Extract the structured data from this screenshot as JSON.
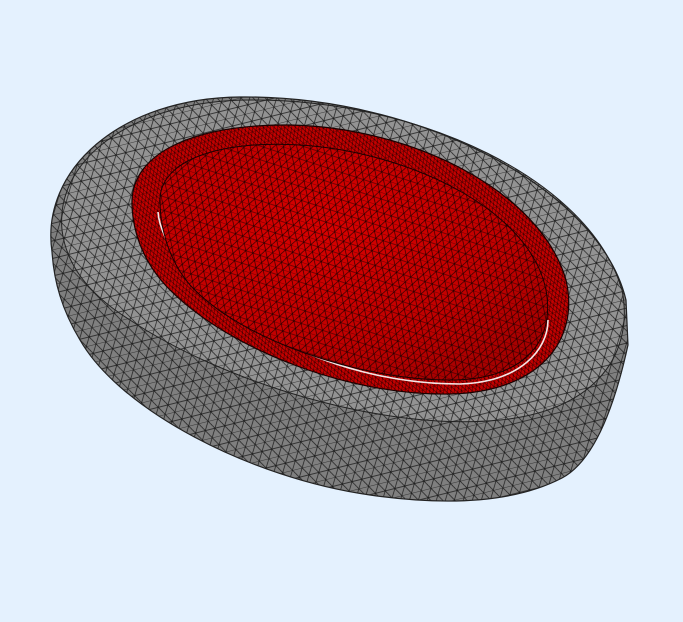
{
  "scene": {
    "object": "mesh-disc-with-dome",
    "colors": {
      "background": "#e4f1fe",
      "rim": "#8a8a8a",
      "rim_side": "#7f7f7f",
      "rim_top": "#939393",
      "cavity": "#c40000",
      "dome": "#cc0000",
      "mesh_lines": "#111111"
    }
  }
}
